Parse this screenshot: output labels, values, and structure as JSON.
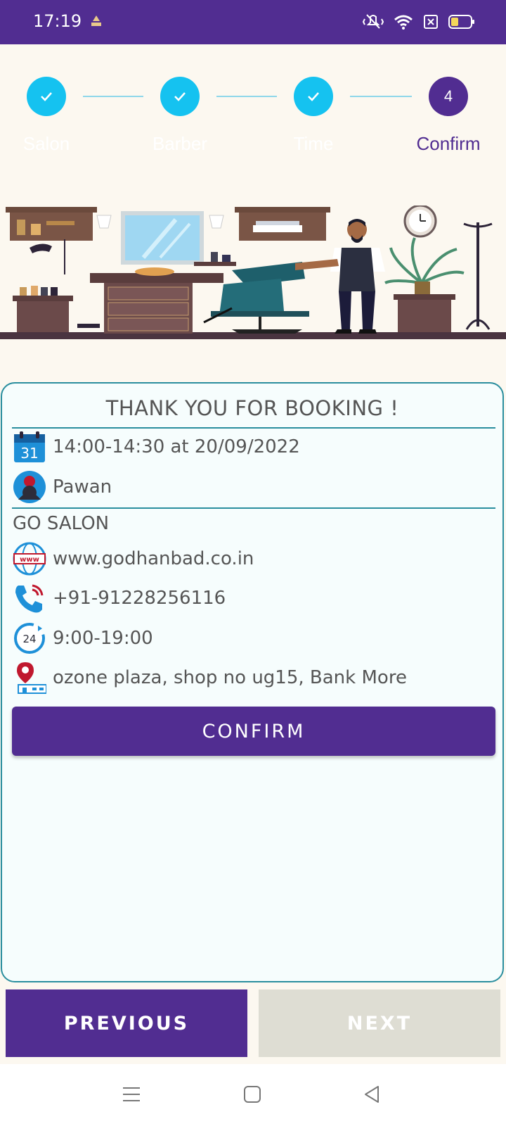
{
  "status_bar": {
    "time": "17:19"
  },
  "stepper": {
    "steps": [
      {
        "label": "Salon",
        "state": "done"
      },
      {
        "label": "Barber",
        "state": "done"
      },
      {
        "label": "Time",
        "state": "done"
      },
      {
        "label": "Confirm",
        "state": "active",
        "number": "4"
      }
    ]
  },
  "booking": {
    "title": "THANK YOU FOR BOOKING !",
    "slot": "14:00-14:30 at 20/09/2022",
    "barber": "Pawan",
    "salon_name": "GO SALON",
    "website": "www.godhanbad.co.in",
    "phone": "+91-91228256116",
    "hours": "9:00-19:00",
    "address": "ozone plaza, shop no ug15, Bank More",
    "confirm_label": "CONFIRM"
  },
  "footer": {
    "previous_label": "PREVIOUS",
    "next_label": "NEXT"
  },
  "colors": {
    "primary": "#512d91",
    "accent": "#15c2f0",
    "teal": "#2a8e9e",
    "disabled": "#deddd3"
  }
}
